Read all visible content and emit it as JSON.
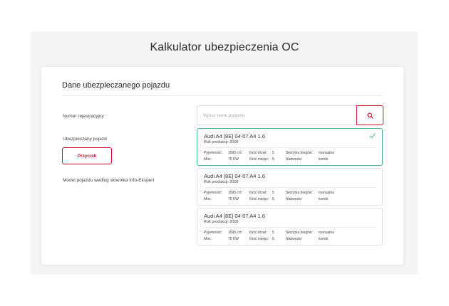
{
  "page": {
    "title": "Kalkulator ubezpieczenia OC"
  },
  "section": {
    "title": "Dane ubezpieczanego pojazdu"
  },
  "form": {
    "registration_label": "Numer rejestracyjny",
    "search_placeholder": "Wpisz dane pojazdu",
    "vehicle_label": "Ubezpieczany pojazd",
    "button_label": "Przycisk",
    "model_label": "Model pojazdu według słownika Info-Ekspert"
  },
  "spec_labels": {
    "capacity": "Pojemność:",
    "doors": "Ilość drzwi:",
    "gearbox": "Skrzynia biegów:",
    "power": "Moc:",
    "seats": "Ilość miejsc:",
    "body": "Nadwozie:"
  },
  "vehicles": [
    {
      "name": "Audi A4 [8E] 04-07 A4 1.6",
      "year": "Rok produkcji: 2005",
      "capacity": "1595 cm",
      "doors": "5",
      "gearbox": "manualna",
      "power": "75 KW",
      "seats": "5",
      "body": "kombi",
      "selected": true
    },
    {
      "name": "Audi A4 [8E] 04-07 A4 1.6",
      "year": "Rok produkcji: 2005",
      "capacity": "1595 cm",
      "doors": "5",
      "gearbox": "manualna",
      "power": "75 KW",
      "seats": "5",
      "body": "kombi",
      "selected": false
    },
    {
      "name": "Audi A4 [8E] 04-07 A4 1.6",
      "year": "Rok produkcji: 2005",
      "capacity": "1595 cm",
      "doors": "5",
      "gearbox": "manualna",
      "power": "75 KW",
      "seats": "5",
      "body": "kombi",
      "selected": false
    }
  ],
  "icons": {
    "search": "search-icon",
    "check": "check-icon"
  },
  "colors": {
    "accent": "#c8102e",
    "selected_border": "#4fb89a"
  }
}
